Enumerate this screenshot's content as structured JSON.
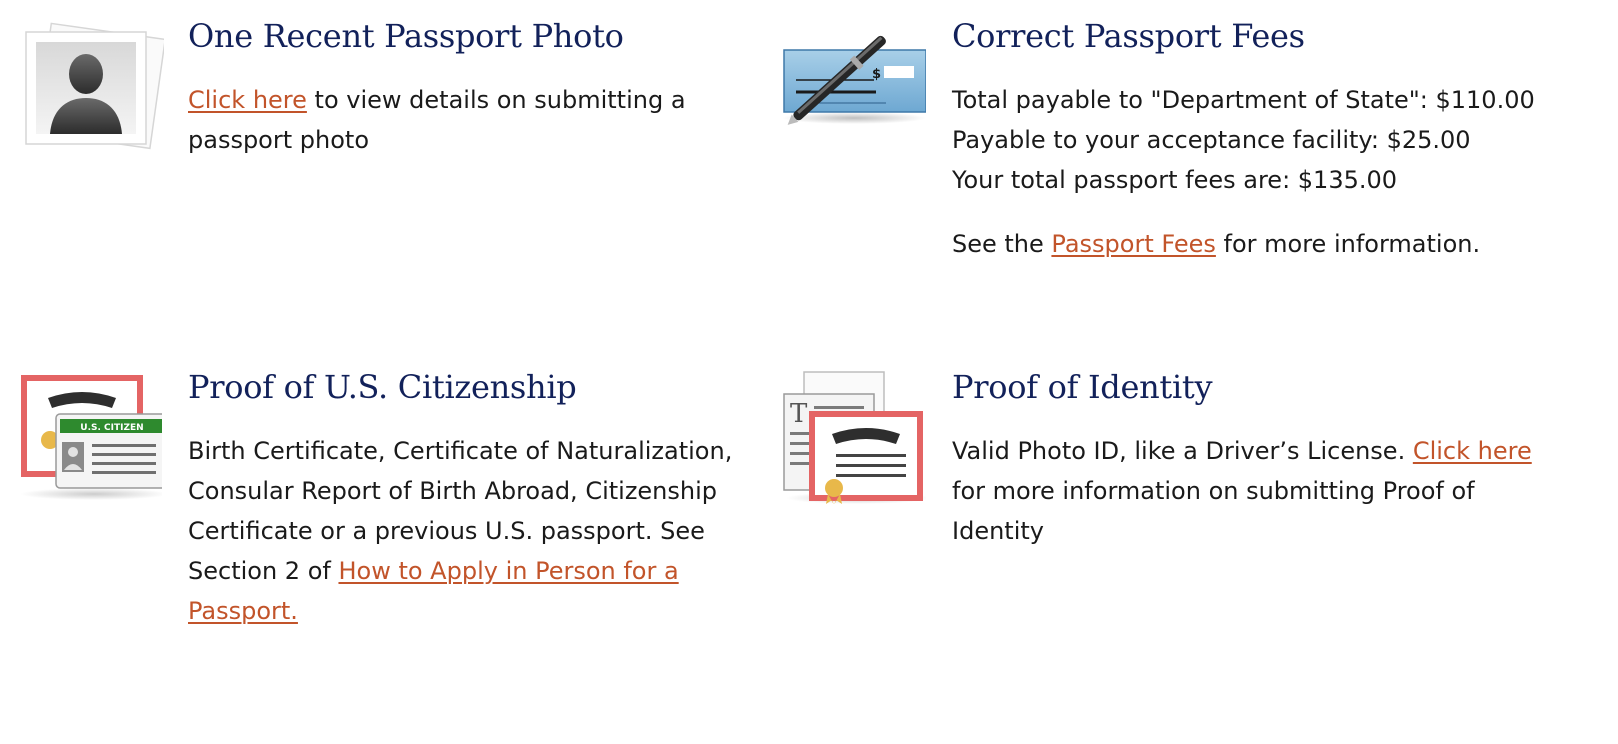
{
  "photo": {
    "title": "One Recent Passport Photo",
    "link_text": "Click here",
    "text_after": " to view details on submitting a passport photo"
  },
  "fees": {
    "title": "Correct Passport Fees",
    "line1": "Total payable to \"Department of State\": $110.00",
    "line2": "Payable to your acceptance facility: $25.00",
    "line3": "Your total passport fees are: $135.00",
    "see_before": "See the ",
    "see_link": "Passport Fees",
    "see_after": " for more information.",
    "check_symbol": "$"
  },
  "citizenship": {
    "title": "Proof of U.S. Citizenship",
    "text_before": "Birth Certificate, Certificate of Naturalization, Consular Report of Birth Abroad, Citizenship Certificate or a previous U.S. passport. See Section 2 of ",
    "link_text": "How to Apply in Person for a Passport.",
    "card_label": "U.S. CITIZEN"
  },
  "identity": {
    "title": "Proof of Identity",
    "text_before": "Valid Photo ID, like a Driver’s License. ",
    "link_text": "Click here",
    "text_after": " for more information on submitting Proof of Identity"
  },
  "colors": {
    "heading": "#12215a",
    "link": "#c2542a",
    "body_text": "#1a1a1a"
  },
  "icons": [
    "person-photo-icon",
    "check-pen-icon",
    "citizen-card-icon",
    "identity-certificate-icon"
  ]
}
